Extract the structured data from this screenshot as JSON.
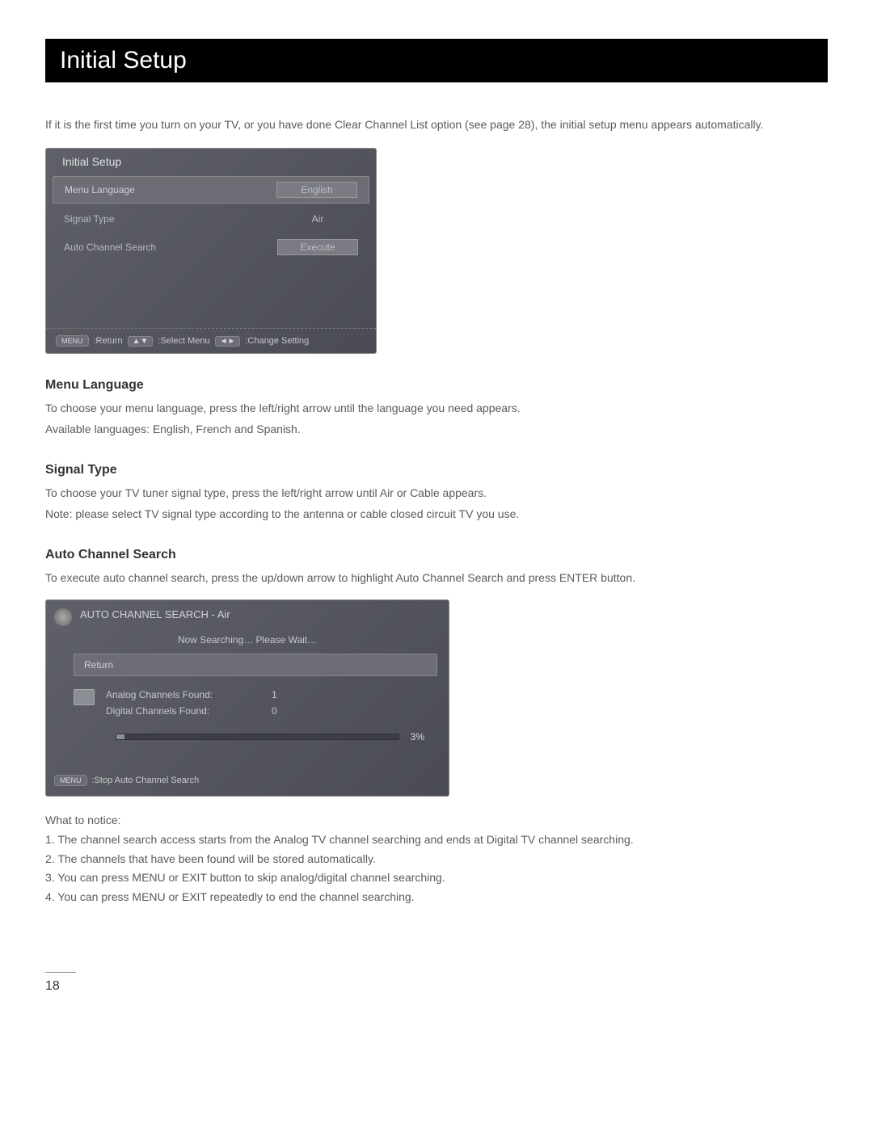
{
  "page_title": "Initial Setup",
  "intro": "If it is the first time you turn on your TV, or you have done Clear Channel List option (see page 28), the initial setup menu appears automatically.",
  "setup_menu": {
    "header": "Initial Setup",
    "rows": [
      {
        "label": "Menu Language",
        "value": "English"
      },
      {
        "label": "Signal Type",
        "value": "Air"
      },
      {
        "label": "Auto Channel Search",
        "value": "Execute"
      }
    ],
    "footer": {
      "return_btn": "MENU",
      "return_label": ":Return",
      "select_label": ":Select Menu",
      "change_label": ":Change Setting"
    }
  },
  "sections": {
    "menu_language": {
      "heading": "Menu Language",
      "lines": [
        "To choose your menu language, press the left/right arrow until the language you need appears.",
        "Available languages: English, French and Spanish."
      ]
    },
    "signal_type": {
      "heading": "Signal Type",
      "lines": [
        "To choose your TV tuner signal type, press the left/right arrow until Air or Cable appears.",
        "Note: please select TV signal type according to the antenna or cable closed circuit TV you use."
      ]
    },
    "auto_search": {
      "heading": "Auto Channel Search",
      "line": "To execute auto channel search, press the up/down arrow to highlight Auto Channel Search and press ENTER button."
    }
  },
  "search_menu": {
    "title": "AUTO CHANNEL SEARCH - Air",
    "subtitle": "Now Searching… Please Wait…",
    "return_label": "Return",
    "results": [
      {
        "label": "Analog Channels Found:",
        "value": "1"
      },
      {
        "label": "Digital Channels Found:",
        "value": "0"
      }
    ],
    "progress_pct": "3%",
    "footer_btn": "MENU",
    "footer_label": ":Stop Auto Channel Search"
  },
  "notice": {
    "heading": "What to notice:",
    "items": [
      "1. The channel search access starts from the Analog TV channel searching and ends at Digital TV channel searching.",
      "2. The channels that have been found will be stored automatically.",
      "3. You can press MENU or EXIT button to skip analog/digital channel searching.",
      "4. You can press MENU or EXIT repeatedly to end the channel searching."
    ]
  },
  "page_number": "18"
}
